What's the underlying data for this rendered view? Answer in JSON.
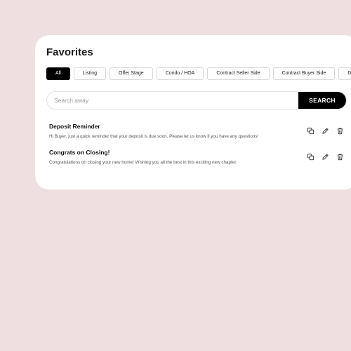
{
  "page": {
    "title": "Favorites"
  },
  "filters": [
    {
      "label": "All",
      "active": true
    },
    {
      "label": "Listing",
      "active": false
    },
    {
      "label": "Offer Stage",
      "active": false
    },
    {
      "label": "Condo / HOA",
      "active": false
    },
    {
      "label": "Contract Seller Side",
      "active": false
    },
    {
      "label": "Contract Buyer Side",
      "active": false
    },
    {
      "label": "Deposits",
      "active": false
    }
  ],
  "search": {
    "placeholder": "Search away",
    "button_label": "SEARCH"
  },
  "messages": [
    {
      "title": "Deposit Reminder",
      "body": "Hi Buyer, just a quick reminder that your deposit is due soon. Please let us know if you have any questions!",
      "actions": [
        "copy-icon",
        "edit-icon",
        "trash-icon"
      ]
    },
    {
      "title": "Congrats on Closing!",
      "body": "Congratulations on closing your new home! Wishing you all the best in this exciting new chapter.",
      "actions": [
        "copy-icon",
        "edit-icon",
        "trash-icon"
      ]
    }
  ],
  "colors": {
    "background": "#efdfe0",
    "card": "#ffffff",
    "accent": "#000000"
  }
}
